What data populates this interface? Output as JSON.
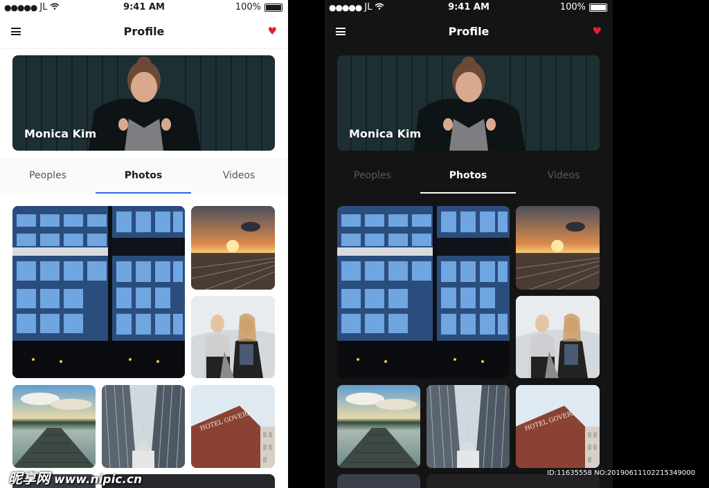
{
  "status_bar": {
    "carrier": "JL",
    "time": "9:41 AM",
    "battery": "100%"
  },
  "header": {
    "title": "Profile"
  },
  "profile": {
    "name": "Monica Kim"
  },
  "tabs": [
    {
      "label": "Peoples"
    },
    {
      "label": "Photos"
    },
    {
      "label": "Videos"
    }
  ],
  "active_tab": "Photos",
  "icons": [
    "menu-icon",
    "heart-icon",
    "wifi-icon",
    "battery-icon",
    "signal-icon"
  ],
  "colors": {
    "accent_light": "#2f67e8",
    "heart": "#e5202e",
    "dark_bg": "#141414"
  },
  "photos": [
    {
      "caption": "Glass office building"
    },
    {
      "caption": "Sunset over rail yard"
    },
    {
      "caption": "Two women in winter"
    },
    {
      "caption": "Pier on a lake"
    },
    {
      "caption": "Dome between glass towers"
    },
    {
      "caption": "HOTEL GOVERNOR"
    }
  ],
  "watermark": {
    "site": "昵享网",
    "url": "www.nipic.cn"
  },
  "image_id": "ID:11635558 NO:20190611102215349000"
}
